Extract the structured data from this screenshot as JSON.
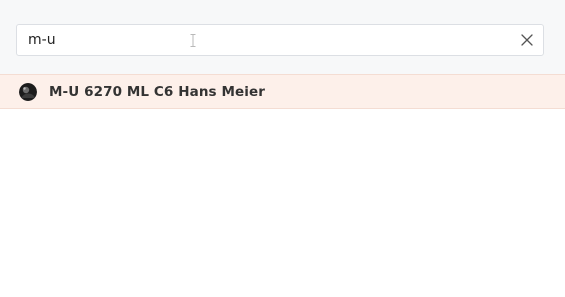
{
  "search": {
    "value": "m-u",
    "icons": {
      "clear": "close-icon",
      "cursor": "text-cursor-icon"
    }
  },
  "results": [
    {
      "label": "M-U 6270 ML C6 Hans Meier",
      "avatar": "person-avatar"
    }
  ],
  "colors": {
    "header_background": "#f7f8f9",
    "highlight_background": "#fdf0ea",
    "input_border": "#dcdfe4",
    "text": "#333333"
  }
}
